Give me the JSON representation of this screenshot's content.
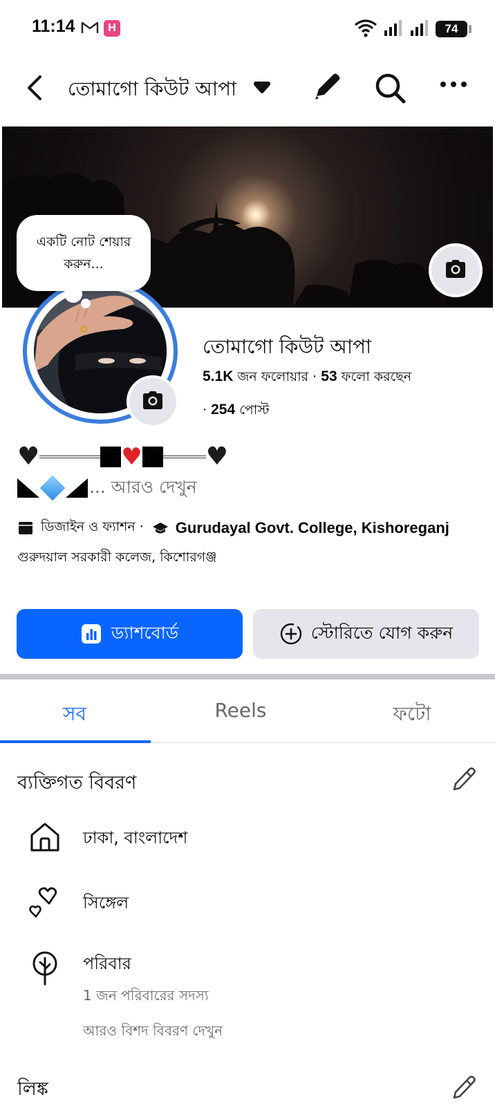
{
  "status_bar": {
    "time": "11:14",
    "h_badge": "H",
    "battery": "74"
  },
  "nav": {
    "title": "তোমাগো কিউট আপা"
  },
  "note": {
    "text": "একটি নোট শেয়ার করুন..."
  },
  "profile": {
    "name": "তোমাগো কিউট আপা",
    "followers_count": "5.1K",
    "followers_label": "জন ফলোয়ার ·",
    "following_count": "53",
    "following_label": "ফলো করছেন",
    "posts_prefix": "·",
    "posts_count": "254",
    "posts_label": "পোস্ট"
  },
  "bio": {
    "see_more": "... আরও দেখুন"
  },
  "info": {
    "category": "ডিজাইন ও ফ্যাশন ·",
    "college_en": "Gurudayal Govt. College, Kishoreganj",
    "college_bn": "গুরুদয়াল সরকারী কলেজ, কিশোরগঞ্জ"
  },
  "buttons": {
    "dashboard": "ড্যাশবোর্ড",
    "add_story": "স্টোরিতে যোগ করুন"
  },
  "tabs": [
    {
      "label": "সব",
      "active": true
    },
    {
      "label": "Reels",
      "active": false
    },
    {
      "label": "ফটো",
      "active": false
    }
  ],
  "personal_details": {
    "title": "ব্যক্তিগত বিবরণ",
    "location": "ঢাকা, বাংলাদেশ",
    "relationship": "সিঙ্গেল",
    "family_title": "পরিবার",
    "family_sub": "1 জন পরিবারের সদস্য",
    "more_details": "আরও বিশদ বিবরণ দেখুন"
  },
  "links": {
    "title": "লিঙ্ক"
  },
  "colors": {
    "accent": "#0866ff",
    "avatar_ring": "#3b7ddd",
    "secondary_button": "#e4e6eb",
    "muted_text": "#65676b"
  }
}
